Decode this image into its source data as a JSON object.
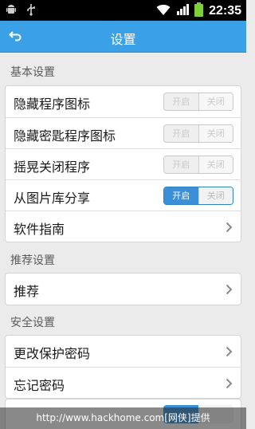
{
  "status_bar": {
    "time": "22:35",
    "icons": [
      "android-debug-icon",
      "usb-icon",
      "wifi-icon",
      "signal-icon",
      "battery-icon"
    ]
  },
  "header": {
    "title": "设置",
    "back_icon": "back-arrow-icon"
  },
  "sections": [
    {
      "title": "基本设置",
      "items": [
        {
          "label": "隐藏程序图标",
          "type": "toggle",
          "on_label": "开启",
          "off_label": "关闭",
          "state": "off"
        },
        {
          "label": "隐藏密匙程序图标",
          "type": "toggle",
          "on_label": "开启",
          "off_label": "关闭",
          "state": "off"
        },
        {
          "label": "摇晃关闭程序",
          "type": "toggle",
          "on_label": "开启",
          "off_label": "关闭",
          "state": "off"
        },
        {
          "label": "从图片库分享",
          "type": "toggle",
          "on_label": "开启",
          "off_label": "关闭",
          "state": "on"
        },
        {
          "label": "软件指南",
          "type": "link"
        }
      ]
    },
    {
      "title": "推荐设置",
      "items": [
        {
          "label": "推荐",
          "type": "link"
        }
      ]
    },
    {
      "title": "安全设置",
      "items": [
        {
          "label": "更改保护密码",
          "type": "link"
        },
        {
          "label": "忘记密码",
          "type": "link"
        }
      ]
    }
  ],
  "watermark": "http://www.hackhome.com[网侠]提供",
  "colors": {
    "titlebar": "#3aa1e6",
    "toggle_on": "#3b8fd6",
    "background": "#ebebeb"
  }
}
